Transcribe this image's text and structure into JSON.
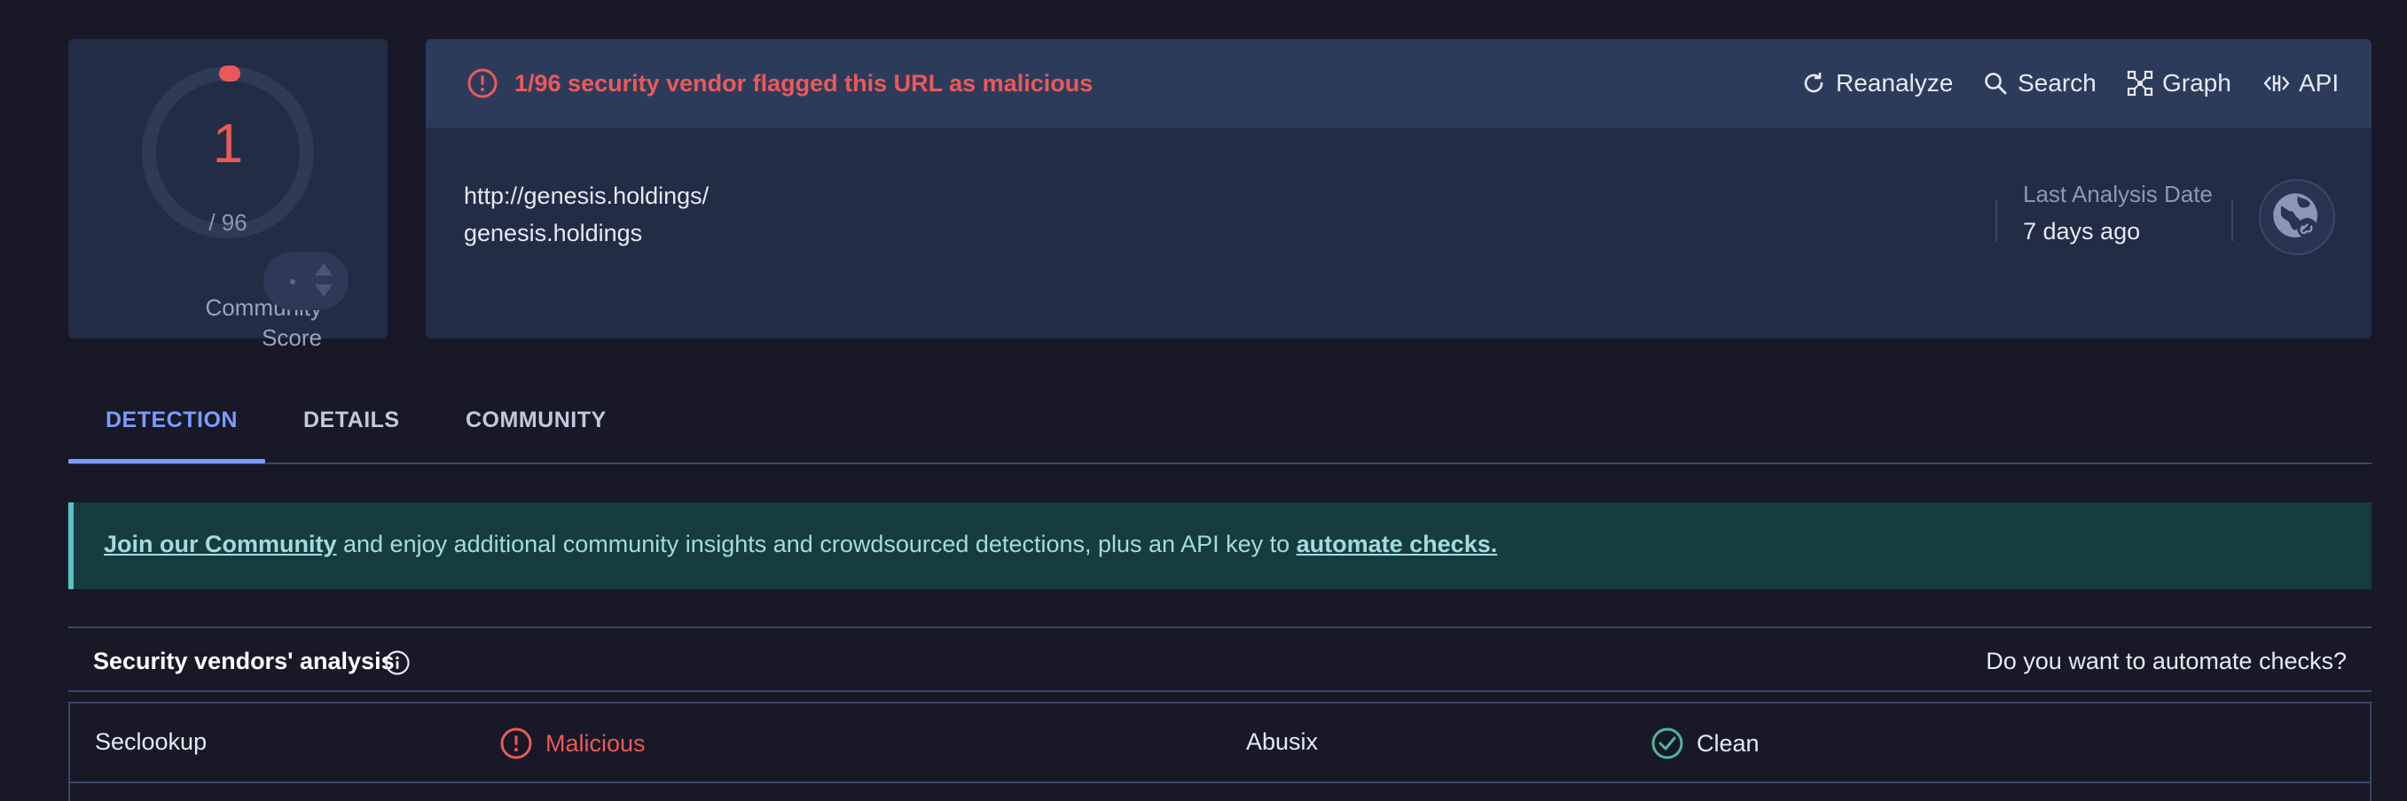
{
  "score": {
    "value": "1",
    "total": "/ 96",
    "community_label_line1": "Community",
    "community_label_line2": "Score",
    "ring_color": "#ea5959"
  },
  "alert": {
    "text": "1/96 security vendor flagged this URL as malicious",
    "color": "#ea5959"
  },
  "actions": {
    "reanalyze": "Reanalyze",
    "search": "Search",
    "graph": "Graph",
    "api": "API"
  },
  "target": {
    "url": "http://genesis.holdings/",
    "domain": "genesis.holdings",
    "last_analysis_label": "Last Analysis Date",
    "last_analysis_value": "7 days ago"
  },
  "tabs": [
    {
      "label": "DETECTION",
      "active": true
    },
    {
      "label": "DETAILS",
      "active": false
    },
    {
      "label": "COMMUNITY",
      "active": false
    }
  ],
  "banner": {
    "link1": "Join our Community",
    "middle": " and enjoy additional community insights and crowdsourced detections, plus an API key to ",
    "link2": "automate checks."
  },
  "vendors": {
    "title": "Security vendors' analysis",
    "automate_prompt": "Do you want to automate checks?",
    "rows": [
      {
        "left": {
          "name": "Seclookup",
          "verdict": "Malicious"
        },
        "right": {
          "name": "Abusix",
          "verdict": "Clean"
        }
      }
    ]
  }
}
